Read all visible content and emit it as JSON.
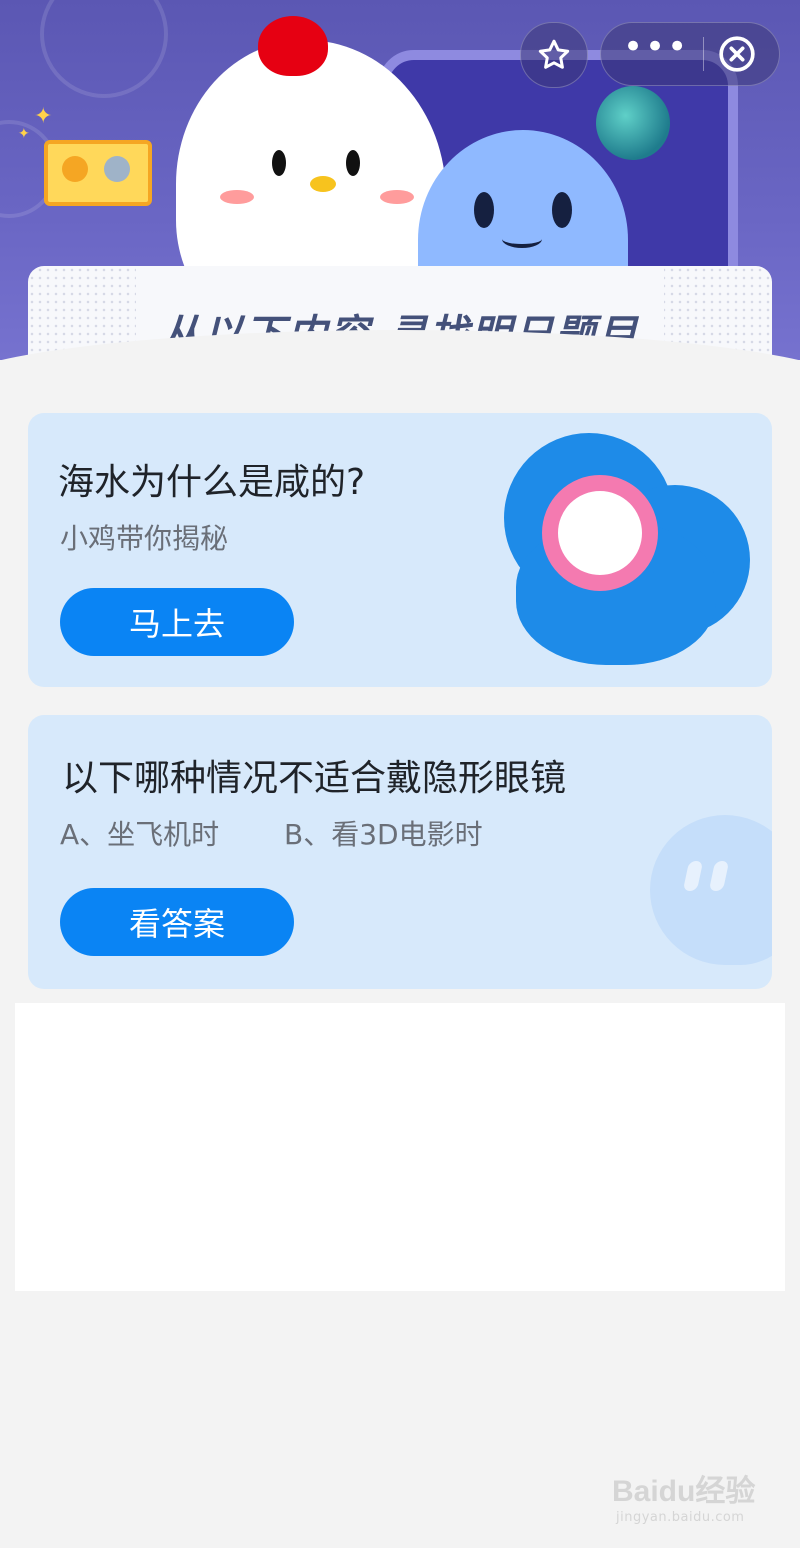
{
  "banner": {
    "title": "从以下内容 寻找明日题目"
  },
  "card1": {
    "title": "海水为什么是咸的?",
    "subtitle": "小鸡带你揭秘",
    "button": "马上去"
  },
  "card2": {
    "question": "以下哪种情况不适合戴隐形眼镜",
    "option_a": "A、坐飞机时",
    "option_b": "B、看3D电影时",
    "button": "看答案"
  },
  "watermark": {
    "brand": "Baidu经验",
    "url": "jingyan.baidu.com"
  },
  "colors": {
    "accent": "#0a84f4",
    "card_bg": "#d7e9fb",
    "hero": "#5b57b3"
  }
}
